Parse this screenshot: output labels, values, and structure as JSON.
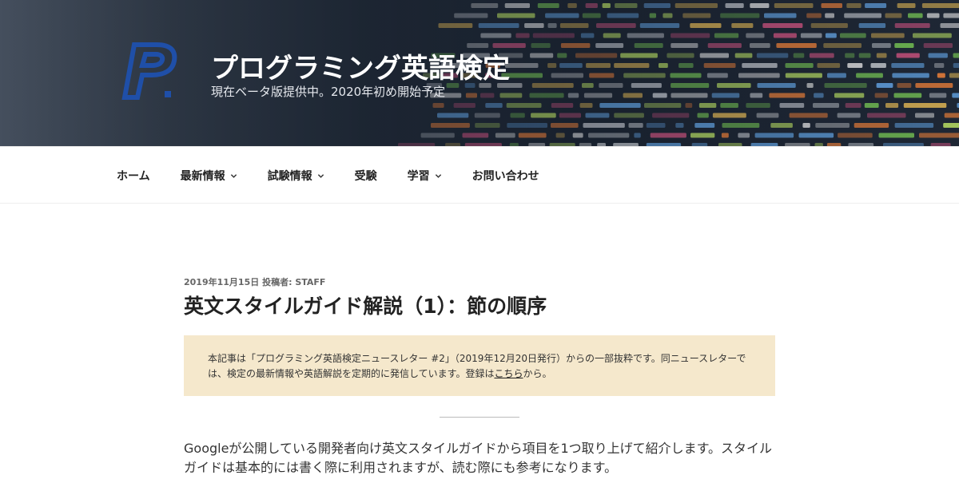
{
  "header": {
    "site_title": "プログラミング英語検定",
    "tagline": "現在ベータ版提供中。2020年初め開始予定",
    "logo_icon": "p-logo-icon",
    "logo_color": "#1f4fa8"
  },
  "nav": {
    "items": [
      {
        "label": "ホーム",
        "has_submenu": false
      },
      {
        "label": "最新情報",
        "has_submenu": true
      },
      {
        "label": "試験情報",
        "has_submenu": true
      },
      {
        "label": "受験",
        "has_submenu": false
      },
      {
        "label": "学習",
        "has_submenu": true
      },
      {
        "label": "お問い合わせ",
        "has_submenu": false
      }
    ]
  },
  "article": {
    "date": "2019年11月15日",
    "author_prefix": "投稿者:",
    "author": "STAFF",
    "title": "英文スタイルガイド解説（1）：節の順序",
    "notice_before_link": "本記事は「プログラミング英語検定ニュースレター #2」（2019年12月20日発行）からの一部抜粋です。同ニュースレターでは、検定の最新情報や英語解説を定期的に発信しています。登録は",
    "notice_link": "こちら",
    "notice_after_link": "から。",
    "notice_bg": "#f5e8cc",
    "body": "Googleが公開している開発者向け英文スタイルガイドから項目を1つ取り上げて紹介します。スタイルガイドは基本的には書く際に利用されますが、読む際にも参考になります。"
  }
}
